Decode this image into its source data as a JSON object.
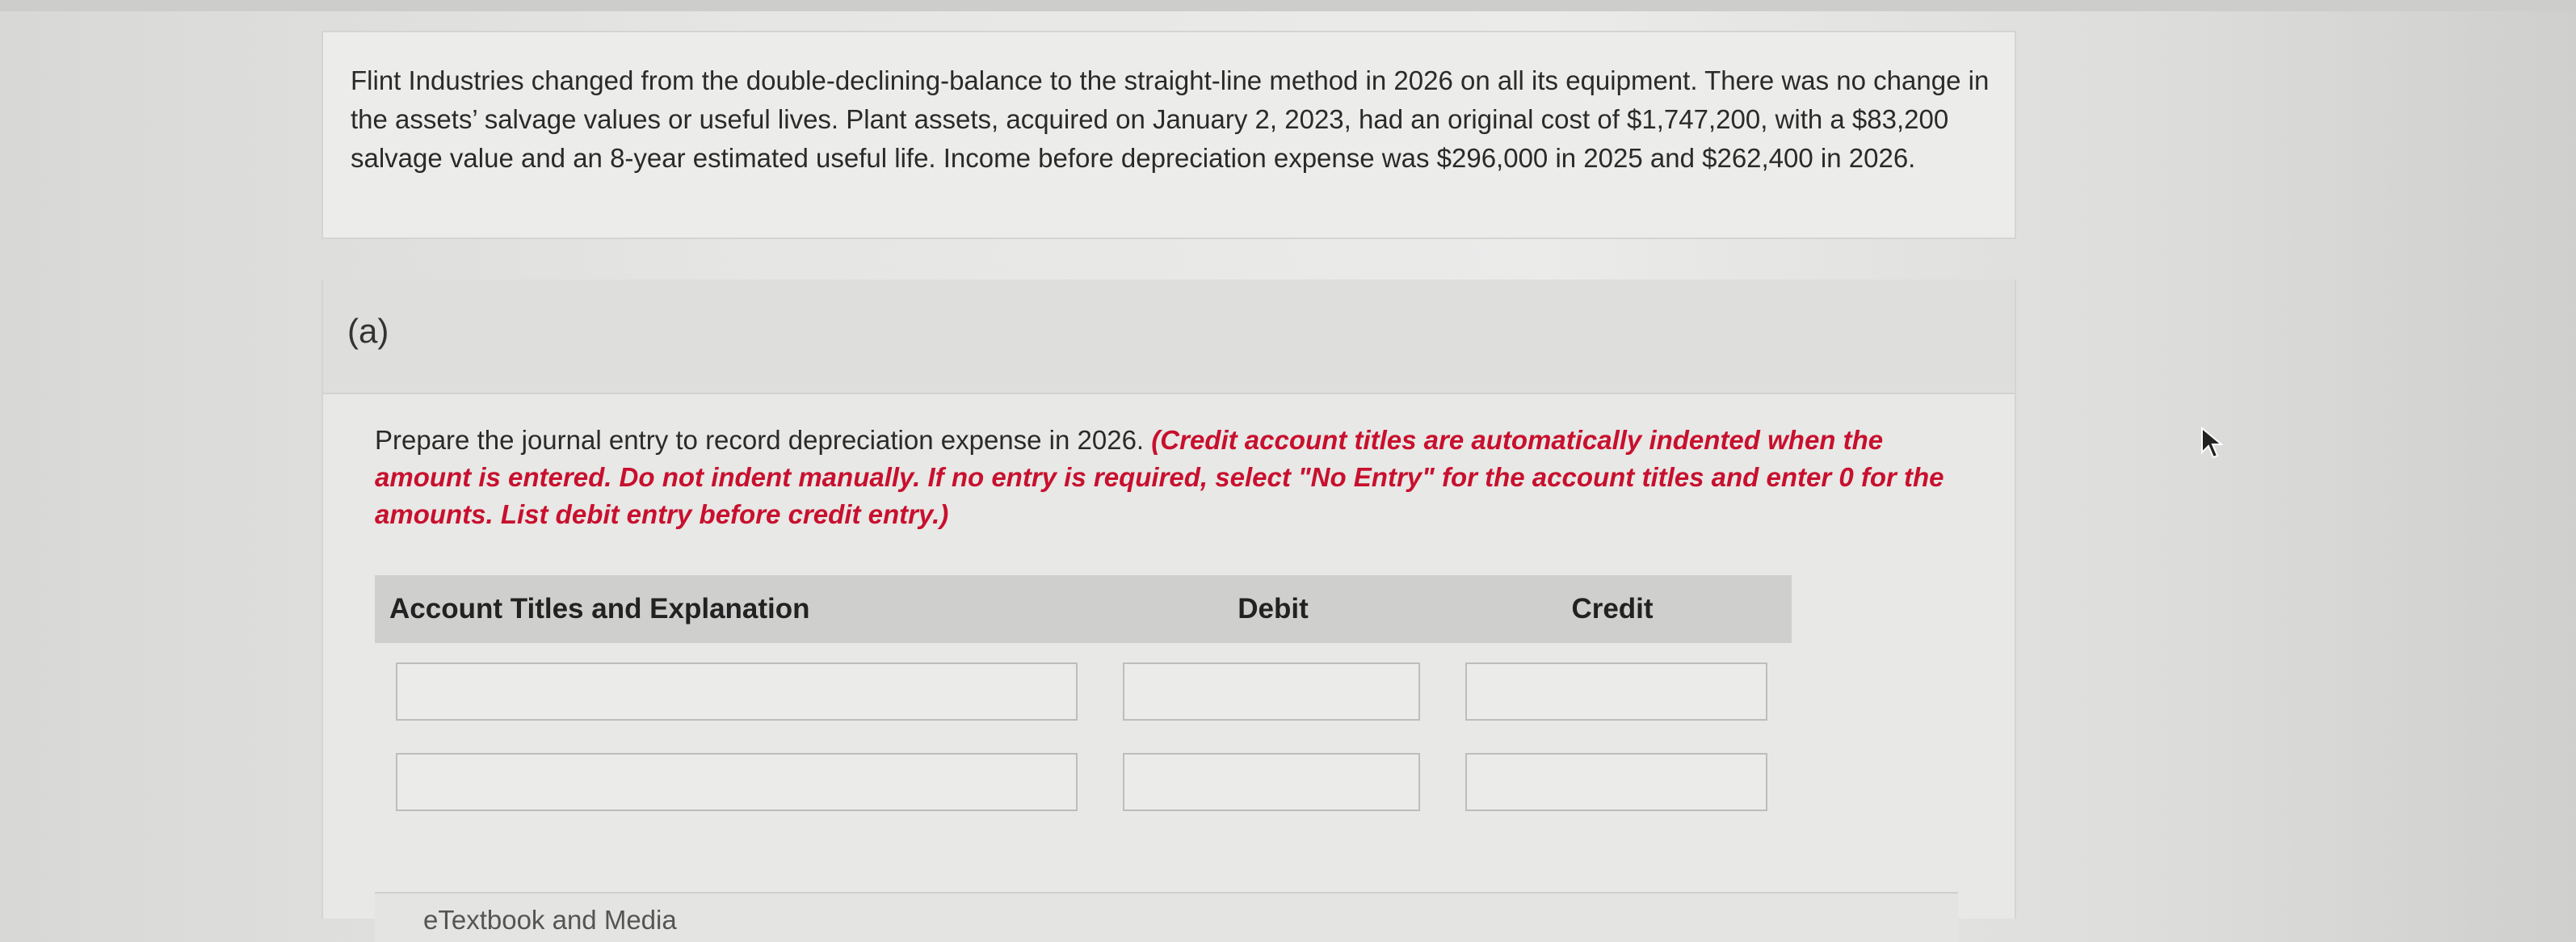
{
  "question": {
    "text": "Flint Industries changed from the double-declining-balance to the straight-line method in 2026 on all its equipment. There was no change in the assets’ salvage values or useful lives. Plant assets, acquired on January 2, 2023, had an original cost of $1,747,200, with a $83,200 salvage value and an 8-year estimated useful life. Income before depreciation expense was $296,000 in 2025 and $262,400 in 2026."
  },
  "part": {
    "label": "(a)",
    "instruction_plain": "Prepare the journal entry to record depreciation expense in 2026. ",
    "instruction_red": "(Credit account titles are automatically indented when the amount is entered. Do not indent manually. If no entry is required, select \"No Entry\" for the account titles and enter 0 for the amounts. List debit entry before credit entry.)"
  },
  "table": {
    "headers": {
      "account": "Account Titles and Explanation",
      "debit": "Debit",
      "credit": "Credit"
    },
    "rows": [
      {
        "account": "",
        "debit": "",
        "credit": ""
      },
      {
        "account": "",
        "debit": "",
        "credit": ""
      }
    ]
  },
  "etextbook": {
    "label": "eTextbook and Media"
  },
  "colors": {
    "instruction_red": "#c8102e",
    "table_header_bg": "#cfcfcd"
  },
  "icons": {
    "cursor": "mouse-pointer-icon"
  }
}
